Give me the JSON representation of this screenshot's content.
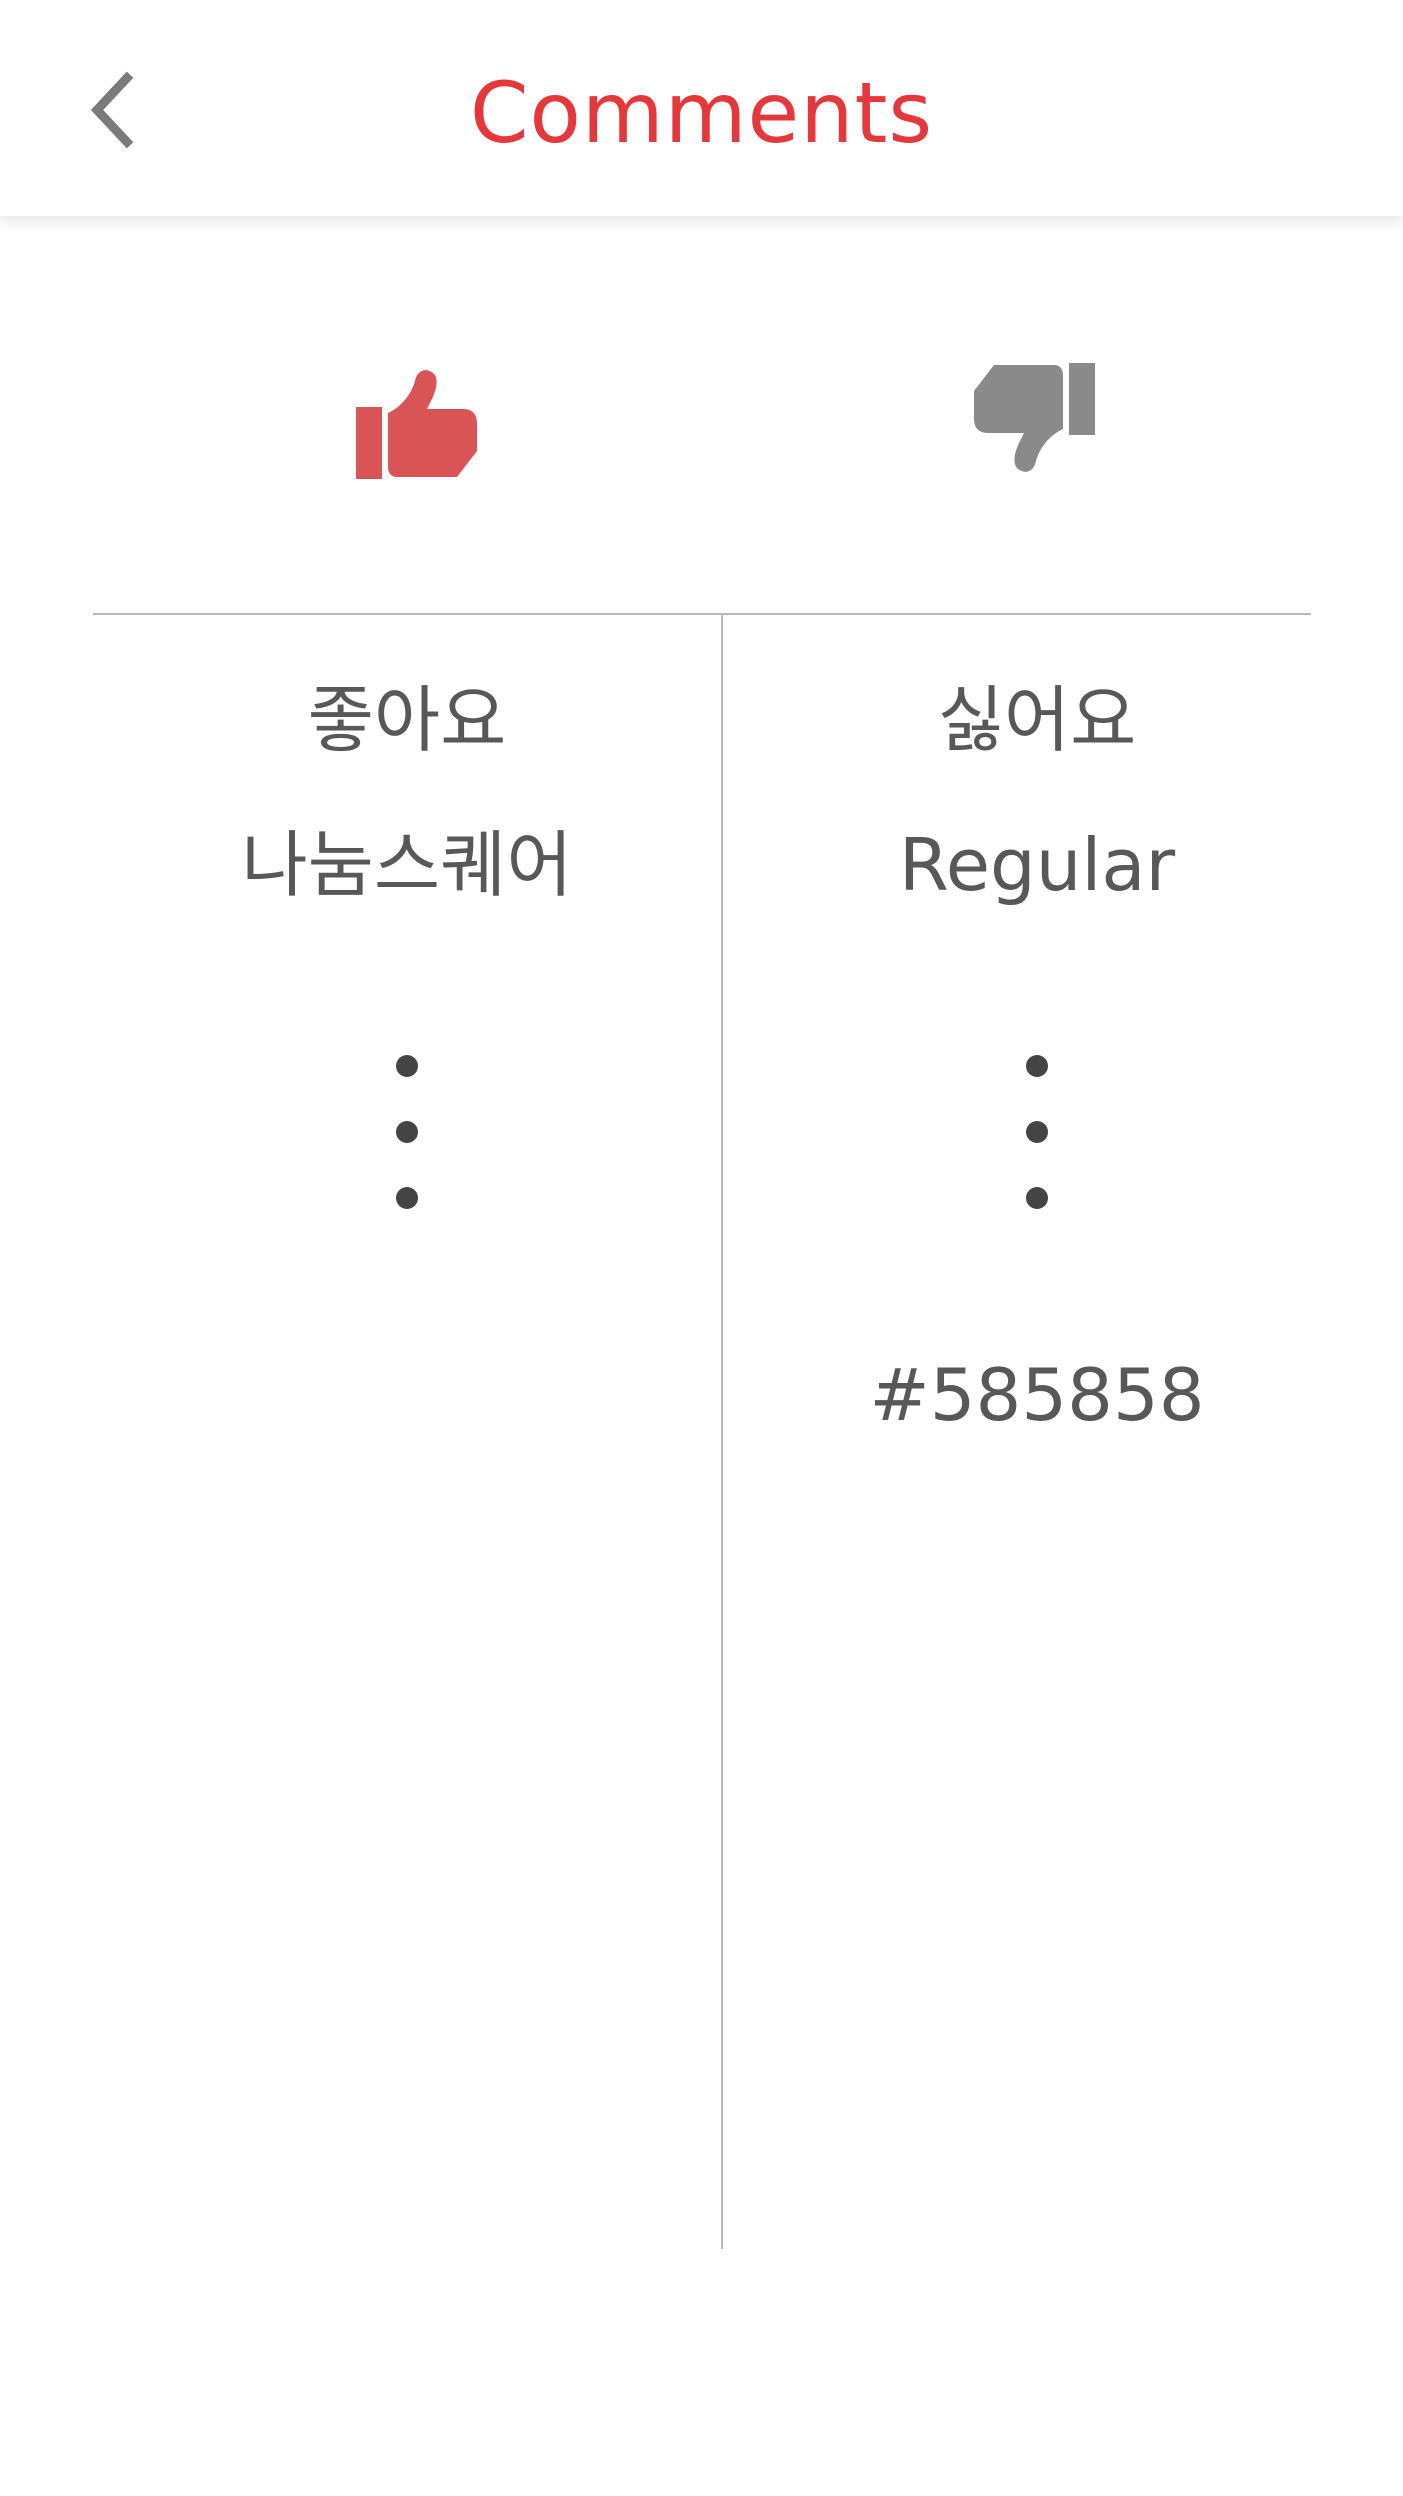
{
  "header": {
    "title": "Comments",
    "back_icon": "chevron-left-icon"
  },
  "colors": {
    "accent": "#e5383b",
    "like_active": "#d95555",
    "dislike_inactive": "#8a8a8a",
    "text": "#585858",
    "divider": "#b9b9b9"
  },
  "votes": {
    "like_icon": "thumbs-up-icon",
    "dislike_icon": "thumbs-down-icon",
    "like_selected": true
  },
  "columns": {
    "left": {
      "title": "좋아요",
      "subtitle": "나눔스퀘어"
    },
    "right": {
      "title": "싫어요",
      "subtitle": "Regular",
      "hex": "#585858"
    }
  }
}
